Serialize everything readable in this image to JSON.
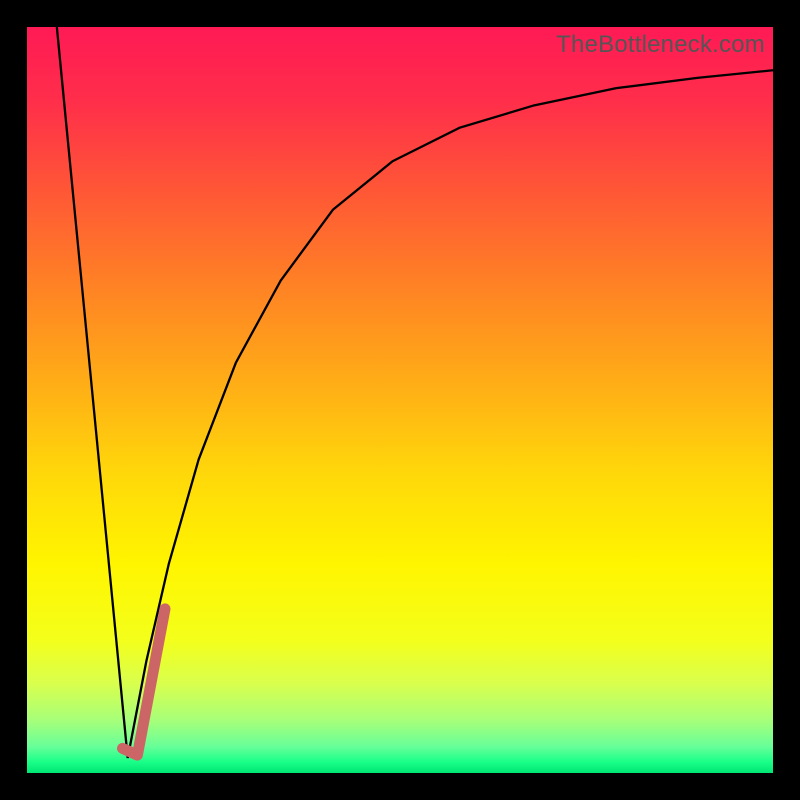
{
  "watermark": "TheBottleneck.com",
  "gradient_stops": [
    {
      "offset": 0.0,
      "color": "#ff1a55"
    },
    {
      "offset": 0.1,
      "color": "#ff2e4a"
    },
    {
      "offset": 0.22,
      "color": "#ff5736"
    },
    {
      "offset": 0.35,
      "color": "#ff8324"
    },
    {
      "offset": 0.48,
      "color": "#ffae16"
    },
    {
      "offset": 0.6,
      "color": "#ffd80a"
    },
    {
      "offset": 0.72,
      "color": "#fff500"
    },
    {
      "offset": 0.82,
      "color": "#f4ff1a"
    },
    {
      "offset": 0.88,
      "color": "#d9ff4d"
    },
    {
      "offset": 0.93,
      "color": "#a6ff7a"
    },
    {
      "offset": 0.965,
      "color": "#66ff99"
    },
    {
      "offset": 0.985,
      "color": "#1aff88"
    },
    {
      "offset": 1.0,
      "color": "#00e673"
    }
  ],
  "chart_data": {
    "type": "line",
    "title": "",
    "xlabel": "",
    "ylabel": "",
    "xlim": [
      0,
      100
    ],
    "ylim": [
      0,
      100
    ],
    "grid": false,
    "series": [
      {
        "name": "bottleneck-curve-left",
        "color": "#000000",
        "width": 2.3,
        "x": [
          4,
          13.5
        ],
        "values": [
          100,
          2
        ]
      },
      {
        "name": "bottleneck-curve-right",
        "color": "#000000",
        "width": 2.3,
        "x": [
          13.5,
          16,
          19,
          23,
          28,
          34,
          41,
          49,
          58,
          68,
          79,
          90,
          100
        ],
        "values": [
          2,
          15,
          28,
          42,
          55,
          66,
          75.5,
          82,
          86.5,
          89.5,
          91.8,
          93.2,
          94.2
        ]
      },
      {
        "name": "highlight-segment",
        "color": "#cc6666",
        "width": 11,
        "linecap": "round",
        "x": [
          12.8,
          14.8,
          18.5
        ],
        "values": [
          3.3,
          2.4,
          22
        ]
      }
    ]
  }
}
